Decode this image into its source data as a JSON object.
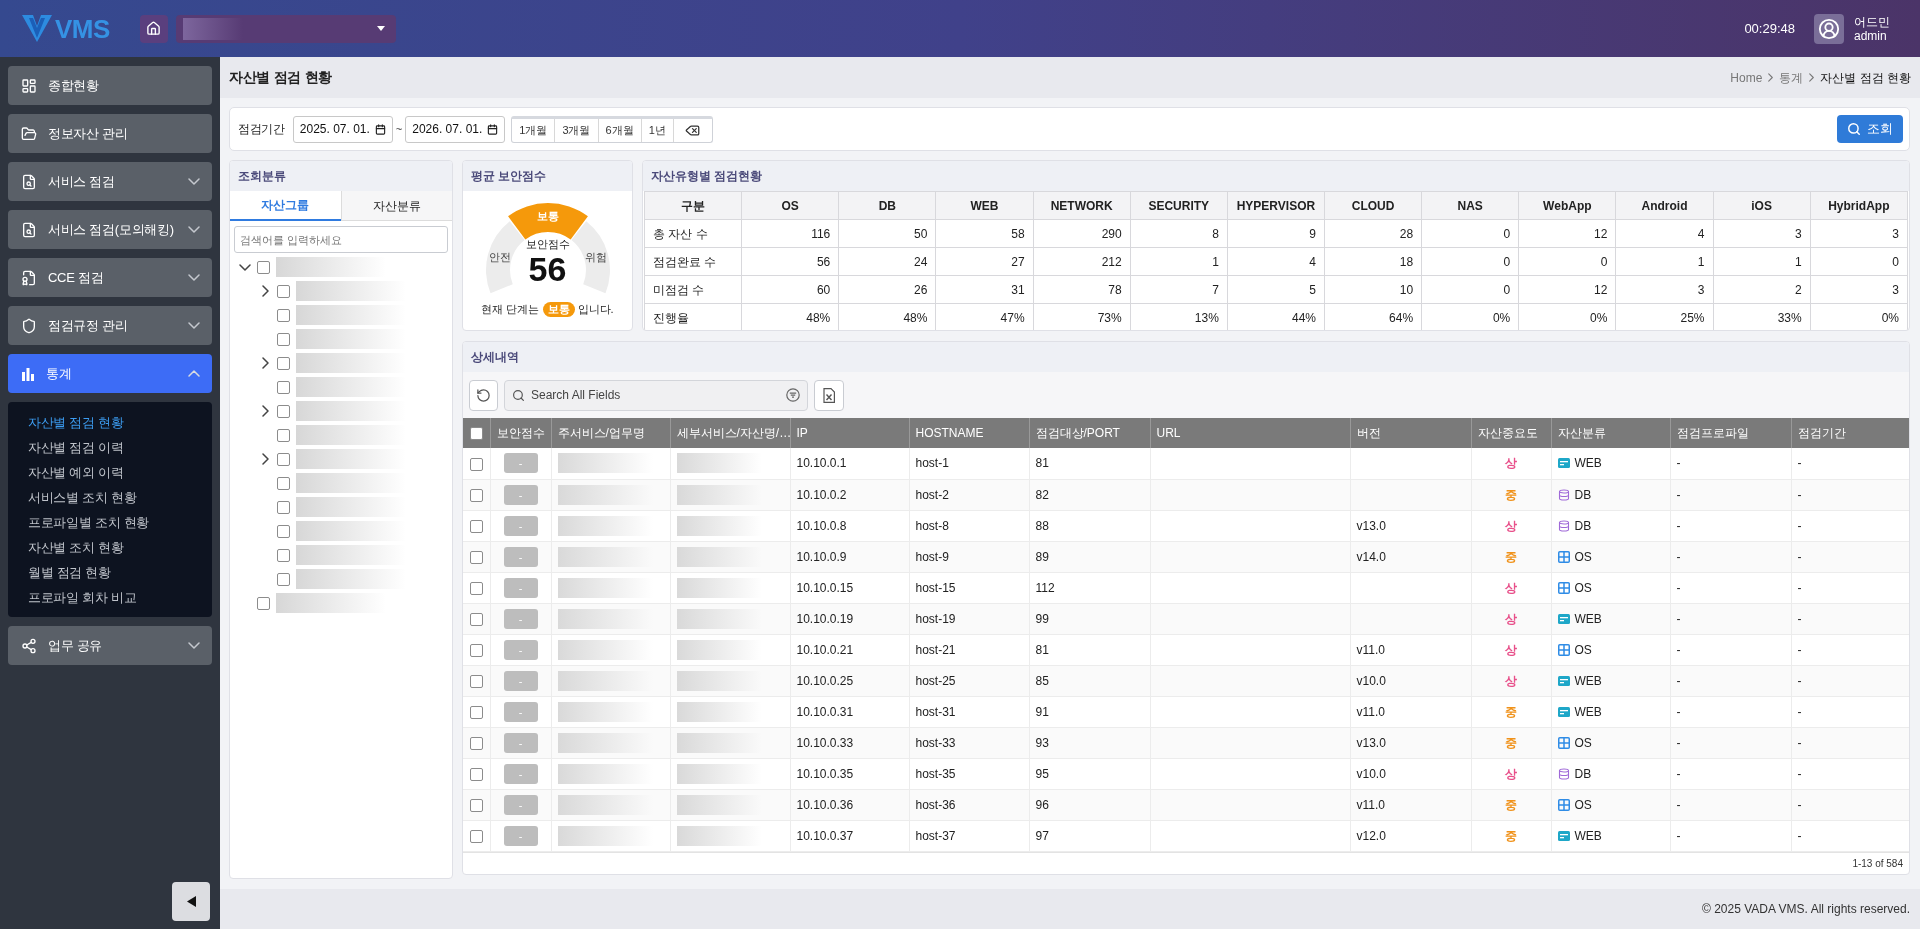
{
  "header": {
    "logo_text": "VMS",
    "time": "00:29:48",
    "user_name": "어드민",
    "user_id": "admin"
  },
  "sidebar": {
    "items": [
      {
        "label": "종합현황",
        "kind": "dashboard",
        "selected": false
      },
      {
        "label": "정보자산 관리",
        "kind": "folder",
        "selected": false
      },
      {
        "label": "서비스 점검",
        "kind": "file-search",
        "selected": false,
        "expanded": false
      },
      {
        "label": "서비스 점검(모의해킹)",
        "kind": "file-search",
        "selected": false,
        "expanded": false
      },
      {
        "label": "CCE 점검",
        "kind": "file-badge",
        "selected": false,
        "expanded": false
      },
      {
        "label": "점검규정 관리",
        "kind": "shield",
        "selected": false,
        "expanded": false
      },
      {
        "label": "통계",
        "kind": "chart",
        "selected": true,
        "expanded": true,
        "children": [
          {
            "label": "자산별 점검 현황",
            "selected": true
          },
          {
            "label": "자산별 점검 이력",
            "selected": false
          },
          {
            "label": "자산별 예외 이력",
            "selected": false
          },
          {
            "label": "서비스별 조치 현황",
            "selected": false
          },
          {
            "label": "프로파일별 조치 현황",
            "selected": false
          },
          {
            "label": "자산별 조치 현황",
            "selected": false
          },
          {
            "label": "월별 점검 현황",
            "selected": false
          },
          {
            "label": "프로파일 회차 비교",
            "selected": false
          }
        ]
      },
      {
        "label": "업무 공유",
        "kind": "share",
        "selected": false,
        "expanded": false
      }
    ]
  },
  "page": {
    "title": "자산별 점검 현황",
    "breadcrumb": [
      "Home",
      "통계",
      "자산별 점검 현황"
    ]
  },
  "filter": {
    "label": "점검기간",
    "date_from": "2025. 07. 01.",
    "separator": "~",
    "date_to": "2026. 07. 01.",
    "quick_ranges": [
      "1개월",
      "3개월",
      "6개월",
      "1년"
    ],
    "search_button": "조회"
  },
  "category_panel": {
    "title": "조회분류",
    "tabs": [
      {
        "label": "자산그룹",
        "selected": true
      },
      {
        "label": "자산분류",
        "selected": false
      }
    ],
    "search": {
      "placeholder": "검색어를 입력하세요"
    },
    "tree": [
      {
        "checked": false,
        "expanded": true,
        "children": [
          {
            "checked": false,
            "expanded": false
          },
          {
            "checked": false
          },
          {
            "checked": false
          },
          {
            "checked": false,
            "expanded": false
          },
          {
            "checked": false
          },
          {
            "checked": false,
            "expanded": false
          },
          {
            "checked": false
          },
          {
            "checked": false,
            "expanded": false
          },
          {
            "checked": false
          },
          {
            "checked": false
          },
          {
            "checked": false
          },
          {
            "checked": false
          },
          {
            "checked": false
          }
        ]
      },
      {
        "checked": false
      }
    ]
  },
  "score_panel": {
    "title": "평균 보안점수",
    "segments": [
      {
        "label": "안전",
        "selected": false
      },
      {
        "label": "보통",
        "selected": true
      },
      {
        "label": "위험",
        "selected": false
      }
    ],
    "score_label": "보안점수",
    "score": "56",
    "status_prefix": "현재 단계는",
    "status_badge": "보통",
    "status_suffix": "입니다."
  },
  "asset_type_panel": {
    "title": "자산유형별 점검현황",
    "columns": [
      "구분",
      "OS",
      "DB",
      "WEB",
      "NETWORK",
      "SECURITY",
      "HYPERVISOR",
      "CLOUD",
      "NAS",
      "WebApp",
      "Android",
      "iOS",
      "HybridApp"
    ],
    "rows": [
      [
        "총 자산 수",
        "116",
        "50",
        "58",
        "290",
        "8",
        "9",
        "28",
        "0",
        "12",
        "4",
        "3",
        "3"
      ],
      [
        "점검완료 수",
        "56",
        "24",
        "27",
        "212",
        "1",
        "4",
        "18",
        "0",
        "0",
        "1",
        "1",
        "0"
      ],
      [
        "미점검 수",
        "60",
        "26",
        "31",
        "78",
        "7",
        "5",
        "10",
        "0",
        "12",
        "3",
        "2",
        "3"
      ],
      [
        "진행율",
        "48%",
        "48%",
        "47%",
        "73%",
        "13%",
        "44%",
        "64%",
        "0%",
        "0%",
        "25%",
        "33%",
        "0%"
      ]
    ]
  },
  "detail_panel": {
    "title": "상세내역",
    "search": {
      "placeholder": "Search All Fields"
    },
    "all_checked": false,
    "columns": [
      "보안점수",
      "주서비스/업무명",
      "세부서비스/자산명/…",
      "IP",
      "HOSTNAME",
      "점검대상/PORT",
      "URL",
      "버전",
      "자산중요도",
      "자산분류",
      "점검프로파일",
      "점검기간"
    ],
    "rows": [
      {
        "checked": false,
        "score": "-",
        "ip": "10.10.0.1",
        "hostname": "host-1",
        "port": "81",
        "importance": {
          "text": "상",
          "color": "#e8508a"
        },
        "asset_type": {
          "kind": "web",
          "label": "WEB"
        },
        "profile": "-",
        "period": "-"
      },
      {
        "checked": false,
        "score": "-",
        "ip": "10.10.0.2",
        "hostname": "host-2",
        "port": "82",
        "importance": {
          "text": "중",
          "color": "#f0921a"
        },
        "asset_type": {
          "kind": "db",
          "label": "DB"
        },
        "profile": "-",
        "period": "-"
      },
      {
        "checked": false,
        "score": "-",
        "ip": "10.10.0.8",
        "hostname": "host-8",
        "port": "88",
        "version": "v13.0",
        "importance": {
          "text": "상",
          "color": "#e8508a"
        },
        "asset_type": {
          "kind": "db",
          "label": "DB"
        },
        "profile": "-",
        "period": "-"
      },
      {
        "checked": false,
        "score": "-",
        "ip": "10.10.0.9",
        "hostname": "host-9",
        "port": "89",
        "version": "v14.0",
        "importance": {
          "text": "중",
          "color": "#f0921a"
        },
        "asset_type": {
          "kind": "os",
          "label": "OS"
        },
        "profile": "-",
        "period": "-"
      },
      {
        "checked": false,
        "score": "-",
        "ip": "10.10.0.15",
        "hostname": "host-15",
        "port": "112",
        "importance": {
          "text": "상",
          "color": "#e8508a"
        },
        "asset_type": {
          "kind": "os",
          "label": "OS"
        },
        "profile": "-",
        "period": "-"
      },
      {
        "checked": false,
        "score": "-",
        "ip": "10.10.0.19",
        "hostname": "host-19",
        "port": "99",
        "importance": {
          "text": "상",
          "color": "#e8508a"
        },
        "asset_type": {
          "kind": "web",
          "label": "WEB"
        },
        "profile": "-",
        "period": "-"
      },
      {
        "checked": false,
        "score": "-",
        "ip": "10.10.0.21",
        "hostname": "host-21",
        "port": "81",
        "version": "v11.0",
        "importance": {
          "text": "상",
          "color": "#e8508a"
        },
        "asset_type": {
          "kind": "os",
          "label": "OS"
        },
        "profile": "-",
        "period": "-"
      },
      {
        "checked": false,
        "score": "-",
        "ip": "10.10.0.25",
        "hostname": "host-25",
        "port": "85",
        "version": "v10.0",
        "importance": {
          "text": "상",
          "color": "#e8508a"
        },
        "asset_type": {
          "kind": "web",
          "label": "WEB"
        },
        "profile": "-",
        "period": "-"
      },
      {
        "checked": false,
        "score": "-",
        "ip": "10.10.0.31",
        "hostname": "host-31",
        "port": "91",
        "version": "v11.0",
        "importance": {
          "text": "중",
          "color": "#f0921a"
        },
        "asset_type": {
          "kind": "web",
          "label": "WEB"
        },
        "profile": "-",
        "period": "-"
      },
      {
        "checked": false,
        "score": "-",
        "ip": "10.10.0.33",
        "hostname": "host-33",
        "port": "93",
        "version": "v13.0",
        "importance": {
          "text": "중",
          "color": "#f0921a"
        },
        "asset_type": {
          "kind": "os",
          "label": "OS"
        },
        "profile": "-",
        "period": "-"
      },
      {
        "checked": false,
        "score": "-",
        "ip": "10.10.0.35",
        "hostname": "host-35",
        "port": "95",
        "version": "v10.0",
        "importance": {
          "text": "상",
          "color": "#e8508a"
        },
        "asset_type": {
          "kind": "db",
          "label": "DB"
        },
        "profile": "-",
        "period": "-"
      },
      {
        "checked": false,
        "score": "-",
        "ip": "10.10.0.36",
        "hostname": "host-36",
        "port": "96",
        "version": "v11.0",
        "importance": {
          "text": "중",
          "color": "#f0921a"
        },
        "asset_type": {
          "kind": "os",
          "label": "OS"
        },
        "profile": "-",
        "period": "-"
      },
      {
        "checked": false,
        "score": "-",
        "ip": "10.10.0.37",
        "hostname": "host-37",
        "port": "97",
        "version": "v12.0",
        "importance": {
          "text": "중",
          "color": "#f0921a"
        },
        "asset_type": {
          "kind": "web",
          "label": "WEB"
        },
        "profile": "-",
        "period": "-"
      }
    ],
    "pagination": "1-13 of 584"
  },
  "footer": {
    "copyright": "© 2025 VADA VMS. All rights reserved."
  }
}
